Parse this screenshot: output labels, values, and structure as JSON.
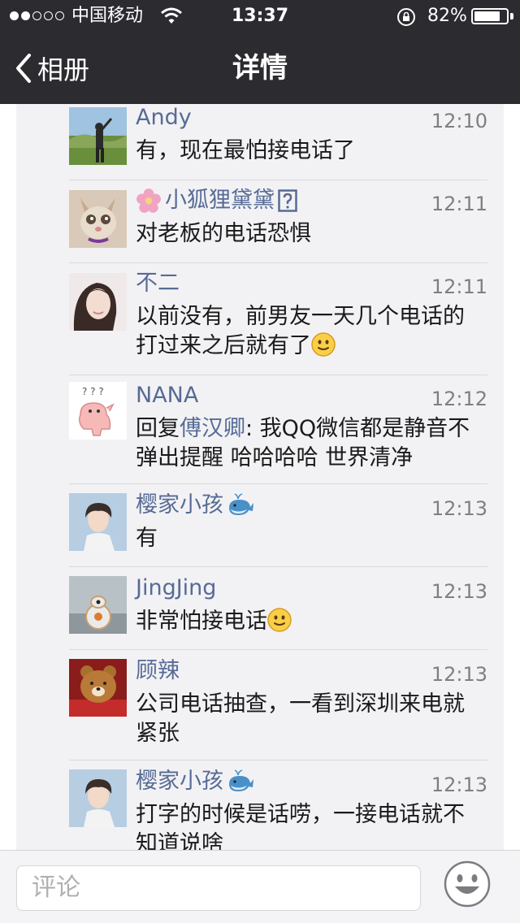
{
  "status": {
    "carrier": "中国移动",
    "time": "13:37",
    "battery": "82%",
    "battery_level": 0.82
  },
  "nav": {
    "back_label": "相册",
    "title": "详情"
  },
  "comments": [
    {
      "name": "Andy",
      "time": "12:10",
      "text": "有，现在最怕接电话了"
    },
    {
      "name": "小狐狸黛黛",
      "time": "12:11",
      "text": "对老板的电话恐惧"
    },
    {
      "name": "不二",
      "time": "12:11",
      "text": "以前没有，前男友一天几个电话的打过来之后就有了"
    },
    {
      "name": "NANA",
      "time": "12:12",
      "reply_prefix": "回复",
      "reply_to": "傅汉卿",
      "text": ": 我QQ微信都是静音不弹出提醒 哈哈哈哈 世界清净"
    },
    {
      "name": "樱家小孩",
      "time": "12:13",
      "text": "有"
    },
    {
      "name": "JingJing",
      "time": "12:13",
      "text": "非常怕接电话"
    },
    {
      "name": "顾辣",
      "time": "12:13",
      "text": "公司电话抽查，一看到深圳来电就紧张"
    },
    {
      "name": "樱家小孩",
      "time": "12:13",
      "text": "打字的时候是话唠，一接电话就不知道说啥"
    }
  ],
  "input": {
    "placeholder": "评论"
  },
  "colors": {
    "bar": "#2c2b30",
    "name": "#576b95",
    "panel": "#f2f2f5"
  }
}
